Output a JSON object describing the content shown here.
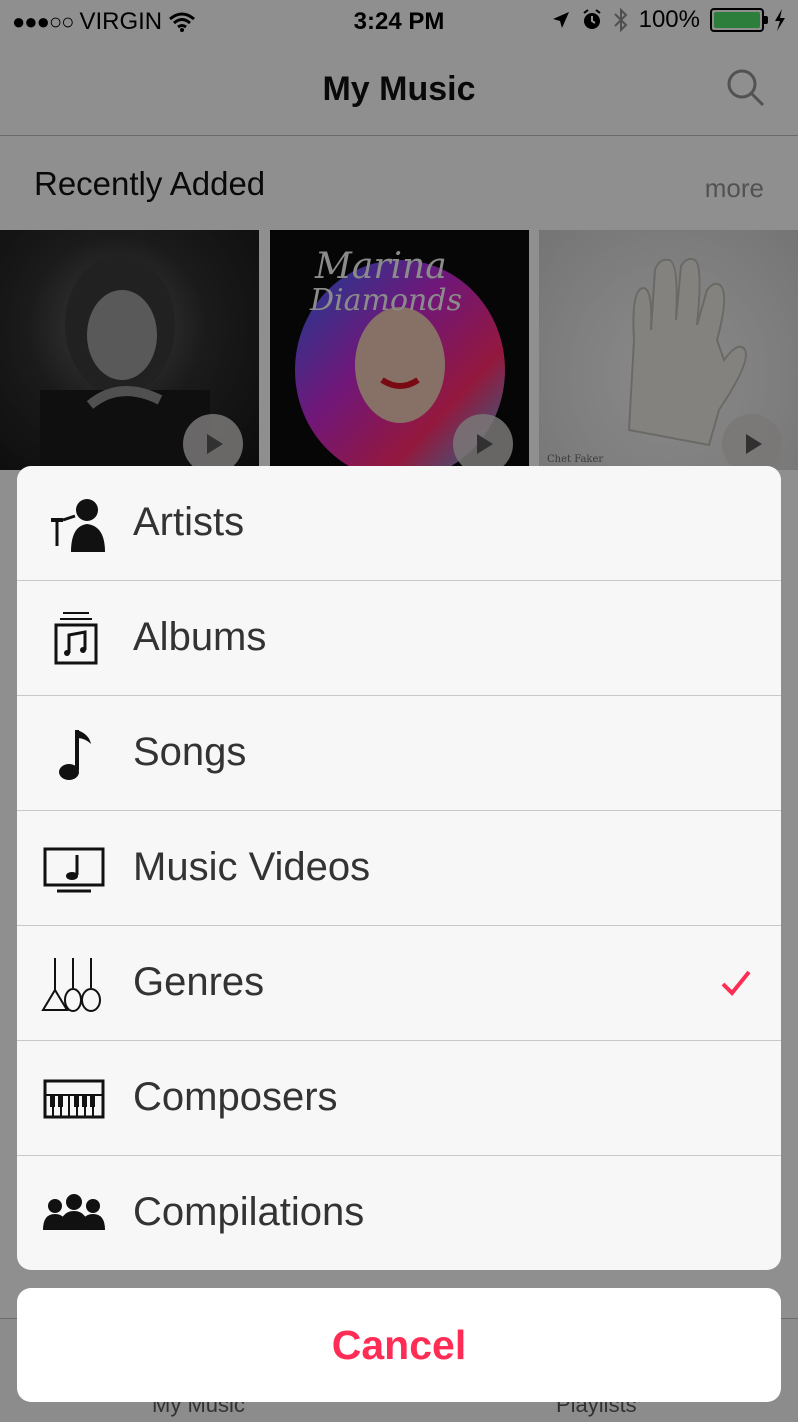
{
  "status": {
    "signal": "●●●○○",
    "carrier": "VIRGIN",
    "time": "3:24 PM",
    "battery": "100%"
  },
  "nav": {
    "title": "My Music"
  },
  "recent": {
    "title": "Recently Added",
    "more": "more",
    "albums": [
      {
        "name": "album-1",
        "caption": ""
      },
      {
        "name": "album-2",
        "caption": "Marina And The Diamonds"
      },
      {
        "name": "album-3",
        "caption": "Chet Faker"
      }
    ]
  },
  "sheet": {
    "items": [
      {
        "label": "Artists",
        "icon": "artist-icon",
        "checked": false
      },
      {
        "label": "Albums",
        "icon": "album-icon",
        "checked": false
      },
      {
        "label": "Songs",
        "icon": "music-note-icon",
        "checked": false
      },
      {
        "label": "Music Videos",
        "icon": "music-video-icon",
        "checked": false
      },
      {
        "label": "Genres",
        "icon": "genres-icon",
        "checked": true
      },
      {
        "label": "Composers",
        "icon": "piano-keyboard-icon",
        "checked": false
      },
      {
        "label": "Compilations",
        "icon": "group-icon",
        "checked": false
      }
    ],
    "cancel": "Cancel"
  },
  "tabs": {
    "my_music": "My Music",
    "playlists": "Playlists"
  },
  "colors": {
    "accent": "#ff2d55",
    "battery": "#4cd964",
    "separator": "#c8c7cc"
  }
}
